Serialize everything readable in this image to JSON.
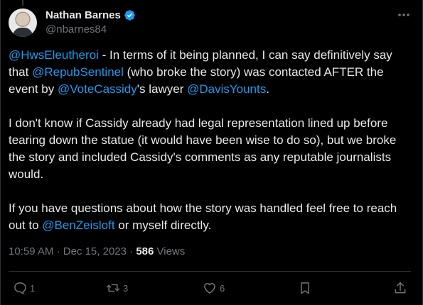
{
  "author": {
    "name": "Nathan Barnes",
    "handle": "@nbarnes84",
    "verified": true
  },
  "tweet": {
    "paragraphs": [
      [
        {
          "type": "mention",
          "text": "@HwsEleutheroi"
        },
        {
          "type": "text",
          "text": " - In terms of it being planned, I can say definitively say that "
        },
        {
          "type": "mention",
          "text": "@RepubSentinel"
        },
        {
          "type": "text",
          "text": " (who broke the story) was contacted AFTER the event by "
        },
        {
          "type": "mention",
          "text": "@VoteCassidy"
        },
        {
          "type": "text",
          "text": "'s lawyer "
        },
        {
          "type": "mention",
          "text": "@DavisYounts"
        },
        {
          "type": "text",
          "text": "."
        }
      ],
      [
        {
          "type": "text",
          "text": "I don't know if Cassidy already had legal representation lined up before tearing down the statue (it would have been wise to do so), but we broke the story and included Cassidy's comments as any reputable journalists would."
        }
      ],
      [
        {
          "type": "text",
          "text": "If you have questions about how the story was handled feel free to reach out to "
        },
        {
          "type": "mention",
          "text": "@BenZeisloft"
        },
        {
          "type": "text",
          "text": " or myself directly."
        }
      ]
    ]
  },
  "meta": {
    "time": "10:59 AM",
    "separator": "·",
    "date": "Dec 15, 2023",
    "views_count": "586",
    "views_label": "Views"
  },
  "actions": {
    "replies": "1",
    "reposts": "3",
    "likes": "6"
  },
  "colors": {
    "background": "#000000",
    "text": "#e7e9ea",
    "muted": "#71767b",
    "link": "#1d9bf0",
    "verified": "#1d9bf0",
    "divider": "#2f3336"
  },
  "icons": {
    "verified": "verified-badge-icon",
    "more": "more-options-icon",
    "reply": "reply-icon",
    "repost": "repost-icon",
    "like": "heart-icon",
    "bookmark": "bookmark-icon",
    "share": "share-icon"
  }
}
